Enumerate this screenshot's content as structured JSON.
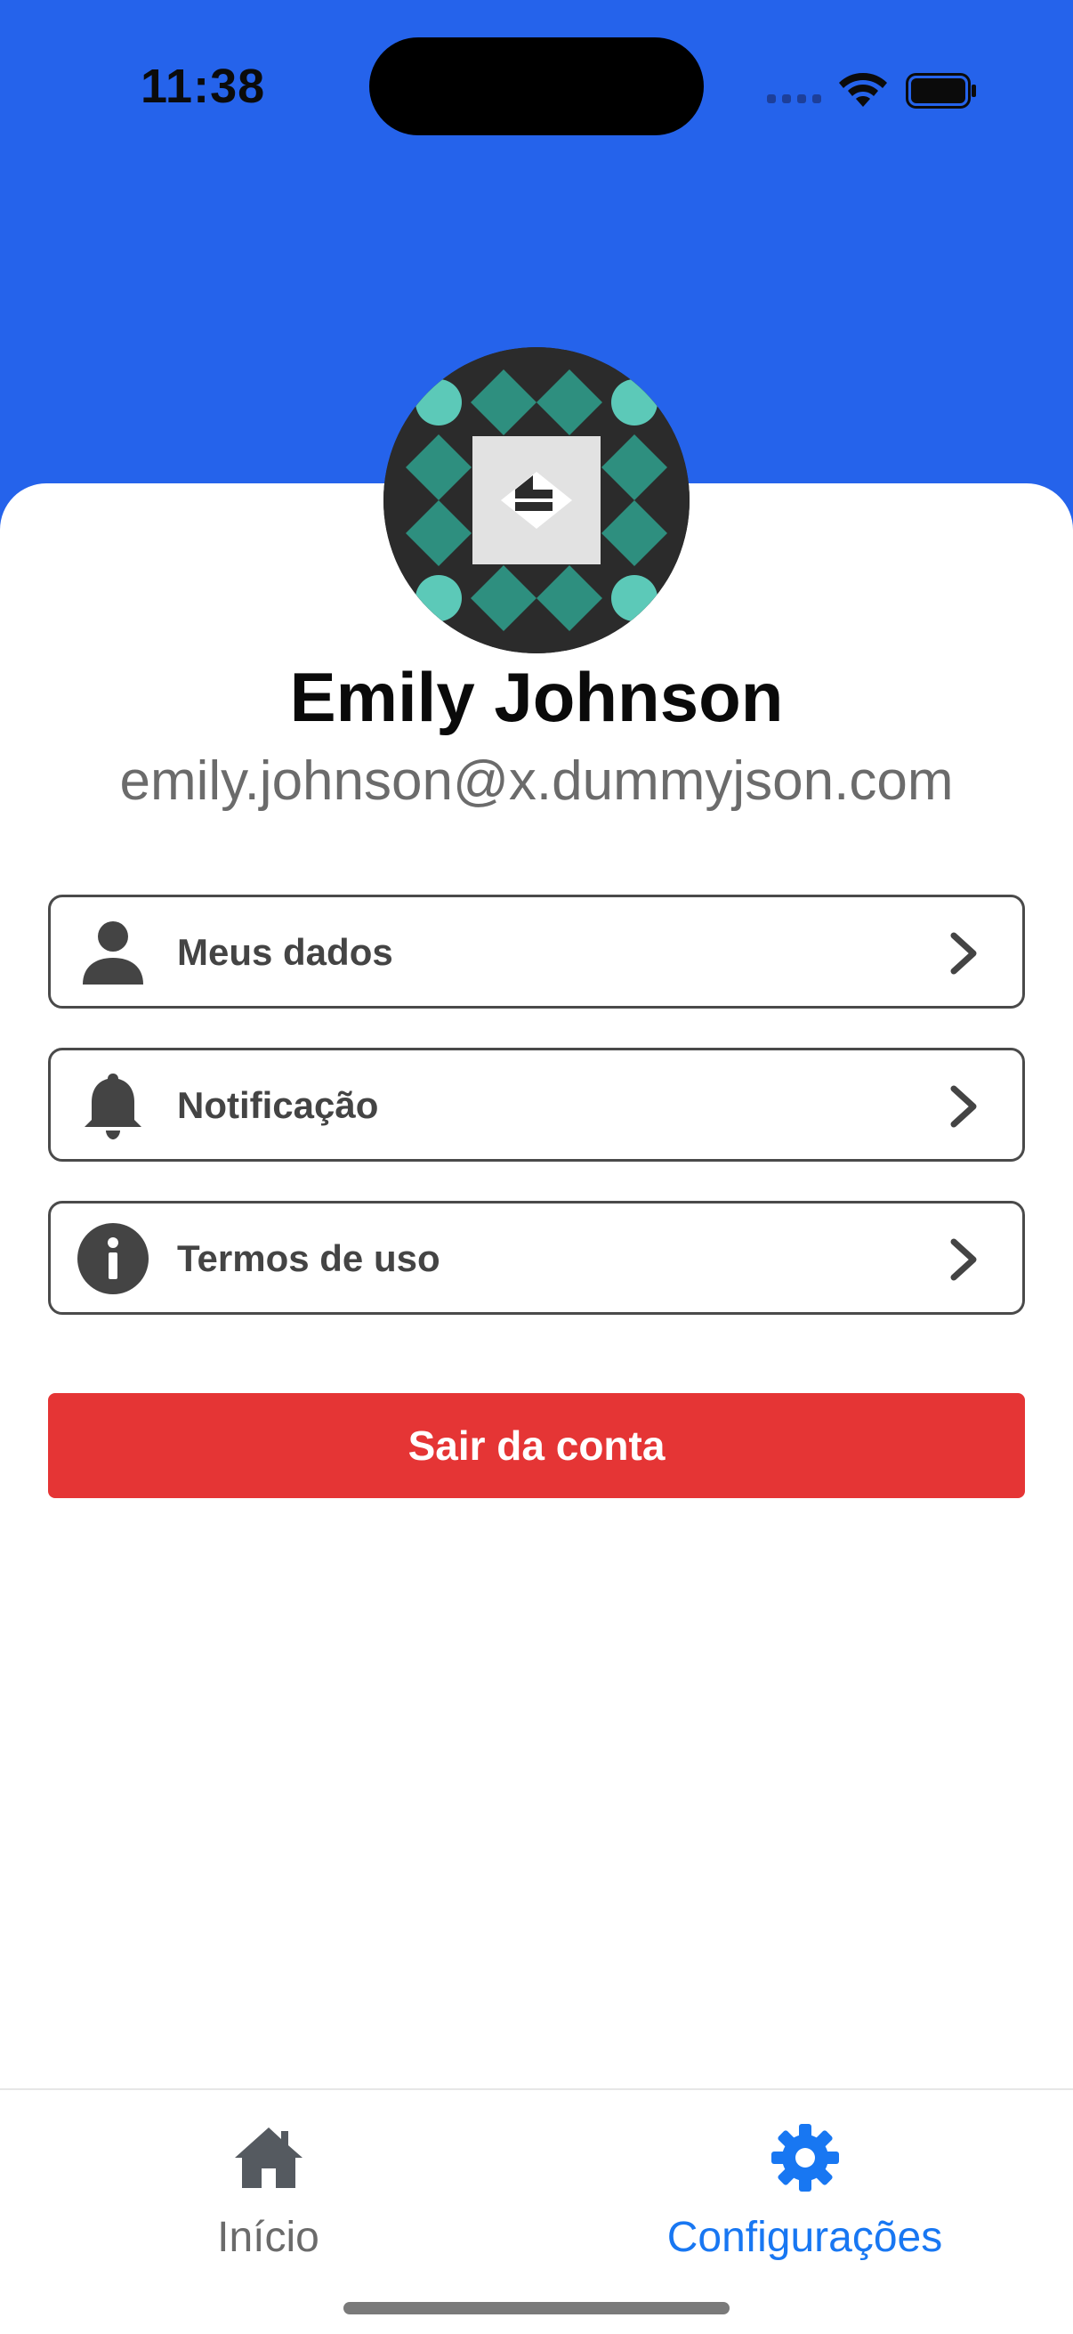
{
  "status_bar": {
    "time": "11:38"
  },
  "profile": {
    "name": "Emily Johnson",
    "email": "emily.johnson@x.dummyjson.com"
  },
  "menu": {
    "items": [
      {
        "label": "Meus dados",
        "icon": "person-icon"
      },
      {
        "label": "Notificação",
        "icon": "bell-icon"
      },
      {
        "label": "Termos de uso",
        "icon": "info-icon"
      }
    ]
  },
  "logout": {
    "label": "Sair da conta"
  },
  "tab_bar": {
    "tabs": [
      {
        "label": "Início",
        "icon": "home-icon",
        "active": false
      },
      {
        "label": "Configurações",
        "icon": "gear-icon",
        "active": true
      }
    ]
  },
  "colors": {
    "header": "#2563EB",
    "logout": "#E53535",
    "active_tab": "#1877F2",
    "inactive_tab": "#6b6b6b"
  }
}
